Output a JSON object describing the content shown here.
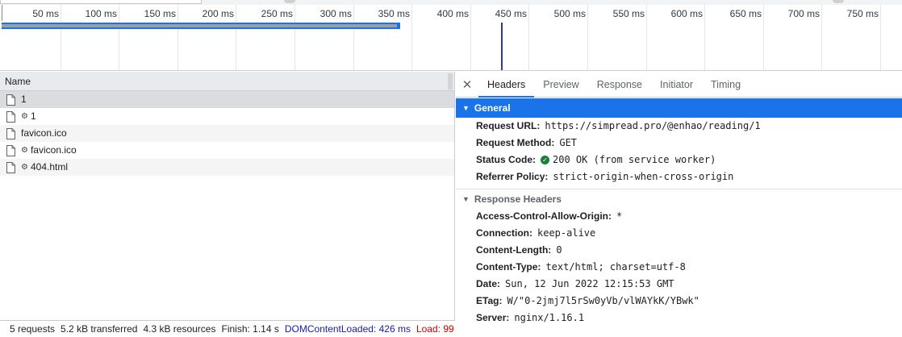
{
  "timeline": {
    "ticks": [
      "50 ms",
      "100 ms",
      "150 ms",
      "200 ms",
      "250 ms",
      "300 ms",
      "350 ms",
      "400 ms",
      "450 ms",
      "500 ms",
      "550 ms",
      "600 ms",
      "650 ms",
      "700 ms",
      "750 ms"
    ],
    "request_end_ms": 340,
    "dom_content_loaded_ms": 426,
    "colors": {
      "request_bar": "#1a73e8",
      "dcl_line": "#2e37a8"
    }
  },
  "request_list": {
    "column_header": "Name",
    "rows": [
      {
        "name": "1",
        "gear": false,
        "icon": "document-icon"
      },
      {
        "name": "1",
        "gear": true,
        "icon": "document-icon"
      },
      {
        "name": "favicon.ico",
        "gear": false,
        "icon": "document-icon"
      },
      {
        "name": "favicon.ico",
        "gear": true,
        "icon": "document-icon"
      },
      {
        "name": "404.html",
        "gear": true,
        "icon": "document-icon"
      }
    ],
    "status": {
      "requests": "5 requests",
      "transferred": "5.2 kB transferred",
      "resources": "4.3 kB resources",
      "finish": "Finish: 1.14 s",
      "dcl": "DOMContentLoaded: 426 ms",
      "load": "Load: 99"
    }
  },
  "details": {
    "tabs": [
      "Headers",
      "Preview",
      "Response",
      "Initiator",
      "Timing"
    ],
    "active_tab": "Headers",
    "general": {
      "title": "General",
      "request_url_label": "Request URL:",
      "request_url": "https://simpread.pro/@enhao/reading/1",
      "request_method_label": "Request Method:",
      "request_method": "GET",
      "status_code_label": "Status Code:",
      "status_code": "200 OK (from service worker)",
      "referrer_policy_label": "Referrer Policy:",
      "referrer_policy": "strict-origin-when-cross-origin"
    },
    "response_headers": {
      "title": "Response Headers",
      "items": [
        {
          "key": "Access-Control-Allow-Origin:",
          "value": "*"
        },
        {
          "key": "Connection:",
          "value": "keep-alive"
        },
        {
          "key": "Content-Length:",
          "value": "0"
        },
        {
          "key": "Content-Type:",
          "value": "text/html; charset=utf-8"
        },
        {
          "key": "Date:",
          "value": "Sun, 12 Jun 2022 12:15:53 GMT"
        },
        {
          "key": "ETag:",
          "value": "W/\"0-2jmj7l5rSw0yVb/vlWAYkK/YBwk\""
        },
        {
          "key": "Server:",
          "value": "nginx/1.16.1"
        }
      ]
    }
  }
}
